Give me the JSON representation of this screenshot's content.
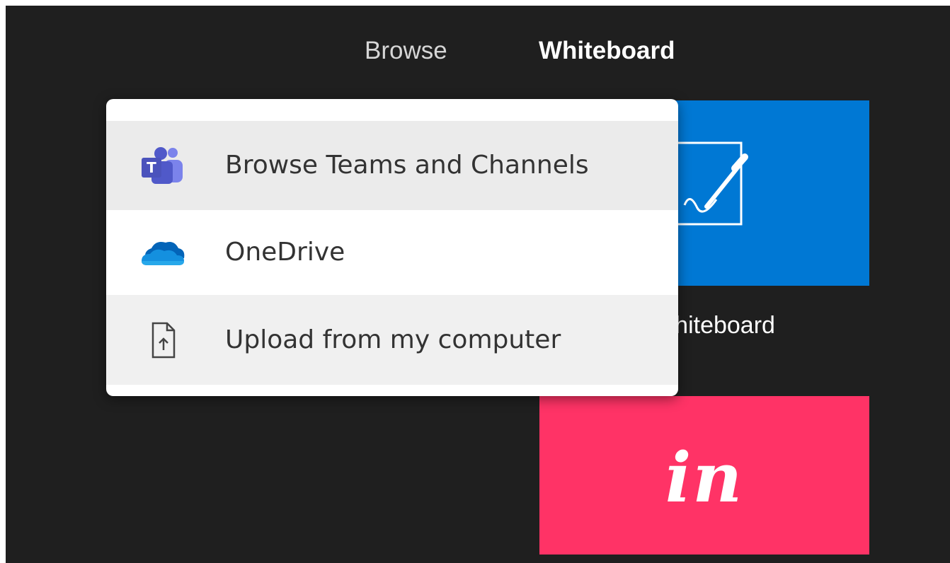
{
  "tabs": {
    "browse_label": "Browse",
    "whiteboard_label": "Whiteboard"
  },
  "menu": {
    "items": [
      {
        "label": "Browse Teams and Channels",
        "icon": "teams-icon"
      },
      {
        "label": "OneDrive",
        "icon": "onedrive-icon"
      },
      {
        "label": "Upload from my computer",
        "icon": "upload-file-icon"
      }
    ]
  },
  "tiles": {
    "whiteboard": {
      "label": "Whiteboard",
      "icon": "whiteboard-pen-icon",
      "color": "#0078d4"
    },
    "invision": {
      "logo_text": "in",
      "color": "#ff3366"
    }
  },
  "colors": {
    "background": "#1f1f1f",
    "menu_hover": "#ebebeb",
    "teams_purple": "#5059c9",
    "onedrive_blue": "#0364b8"
  }
}
